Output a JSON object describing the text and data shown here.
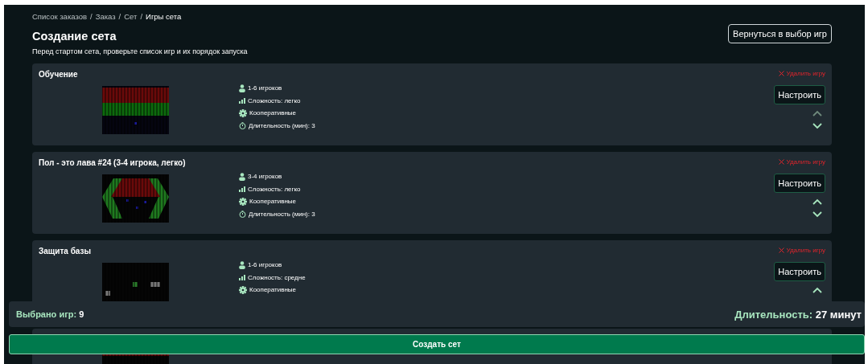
{
  "breadcrumb_separator": "/",
  "breadcrumbs": [
    {
      "label": "Список заказов",
      "current": false
    },
    {
      "label": "Заказ",
      "current": false
    },
    {
      "label": "Сет",
      "current": false
    },
    {
      "label": "Игры сета",
      "current": true
    }
  ],
  "title": "Создание сета",
  "back_button": "Вернуться в выбор игр",
  "subtitle": "Перед стартом сета, проверьте список игр и их порядок запуска",
  "games": [
    {
      "title": "Обучение",
      "preview": {
        "kind": "picture"
      },
      "players": "1-6 игроков",
      "difficulty": "Сложность: легко",
      "mode": "Кооперативные",
      "duration": "Длительность (мин): 3",
      "delete": "Удалить игру",
      "configure": "Настроить",
      "move_up": {
        "disabled": true
      },
      "move_down": {
        "disabled": false
      }
    },
    {
      "title": "Пол - это лава #24 (3-4 игрока, легко)",
      "preview": {
        "kind": "picture"
      },
      "players": "3-4 игроков",
      "difficulty": "Сложность: легко",
      "mode": "Кооперативные",
      "duration": "Длительность (мин): 3",
      "delete": "Удалить игру",
      "configure": "Настроить",
      "move_up": {
        "disabled": false
      },
      "move_down": {
        "disabled": false
      }
    },
    {
      "title": "Защита базы",
      "preview": {
        "kind": "picture"
      },
      "players": "1-6 игроков",
      "difficulty": "Сложность: средне",
      "mode": "Кооперативные",
      "delete": "Удалить игру",
      "configure": "Настроить",
      "move_up": {
        "disabled": false
      }
    },
    {
      "preview": {
        "kind": "picture"
      }
    }
  ],
  "summary": {
    "count_label": "Выбрано игр:",
    "count": "9",
    "duration_label": "Длительность:",
    "duration": "27 минут"
  },
  "create_button": "Создать сет"
}
